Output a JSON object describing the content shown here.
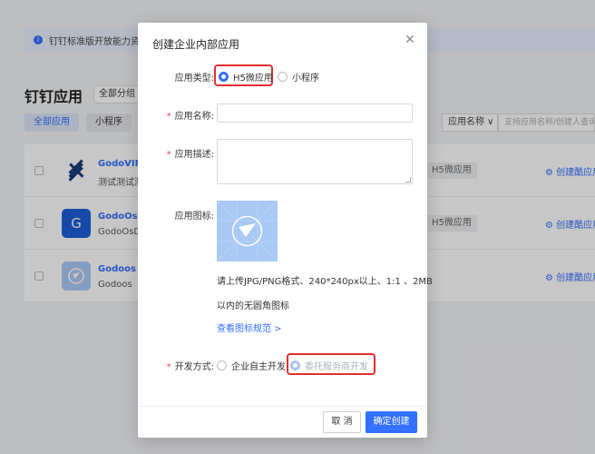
{
  "background": {
    "notice": "钉钉标准版开放能力资源",
    "page_title": "钉钉应用",
    "group_select": "全部分组",
    "tabs": [
      "全部应用",
      "小程序"
    ],
    "filter_select": "应用名称 ∨",
    "filter_search_placeholder": "支持应用名称/创建人查询",
    "rows": [
      {
        "name": "GodoVIP",
        "desc": "测试测试测",
        "type": "H5微应用",
        "action": "创建酷应用"
      },
      {
        "name": "GodoOsDe",
        "desc": "GodoOsDe",
        "type": "H5微应用",
        "action": "创建酷应用"
      },
      {
        "name": "Godoos",
        "desc": "Godoos",
        "type": "",
        "action": "创建酷应用"
      }
    ]
  },
  "modal": {
    "title": "创建企业内部应用",
    "app_type_label": "应用类型:",
    "app_type_options": [
      "H5微应用",
      "小程序"
    ],
    "app_name_label": "应用名称:",
    "app_name_value": "",
    "app_desc_label": "应用描述:",
    "app_desc_value": "",
    "app_icon_label": "应用图标:",
    "icon_hint_line1": "请上传JPG/PNG格式、240*240px以上、1:1 、2MB",
    "icon_hint_line2": "以内的无圆角图标",
    "icon_guide_link": "查看图标规范 >",
    "dev_mode_label": "开发方式:",
    "dev_mode_options": [
      "企业自主开发",
      "委托服务商开发"
    ],
    "required_mark": "*",
    "cancel_label": "取 消",
    "confirm_label": "确定创建"
  },
  "colors": {
    "accent": "#3370ff",
    "highlight": "#e02f2f",
    "required": "#f23c3c"
  }
}
